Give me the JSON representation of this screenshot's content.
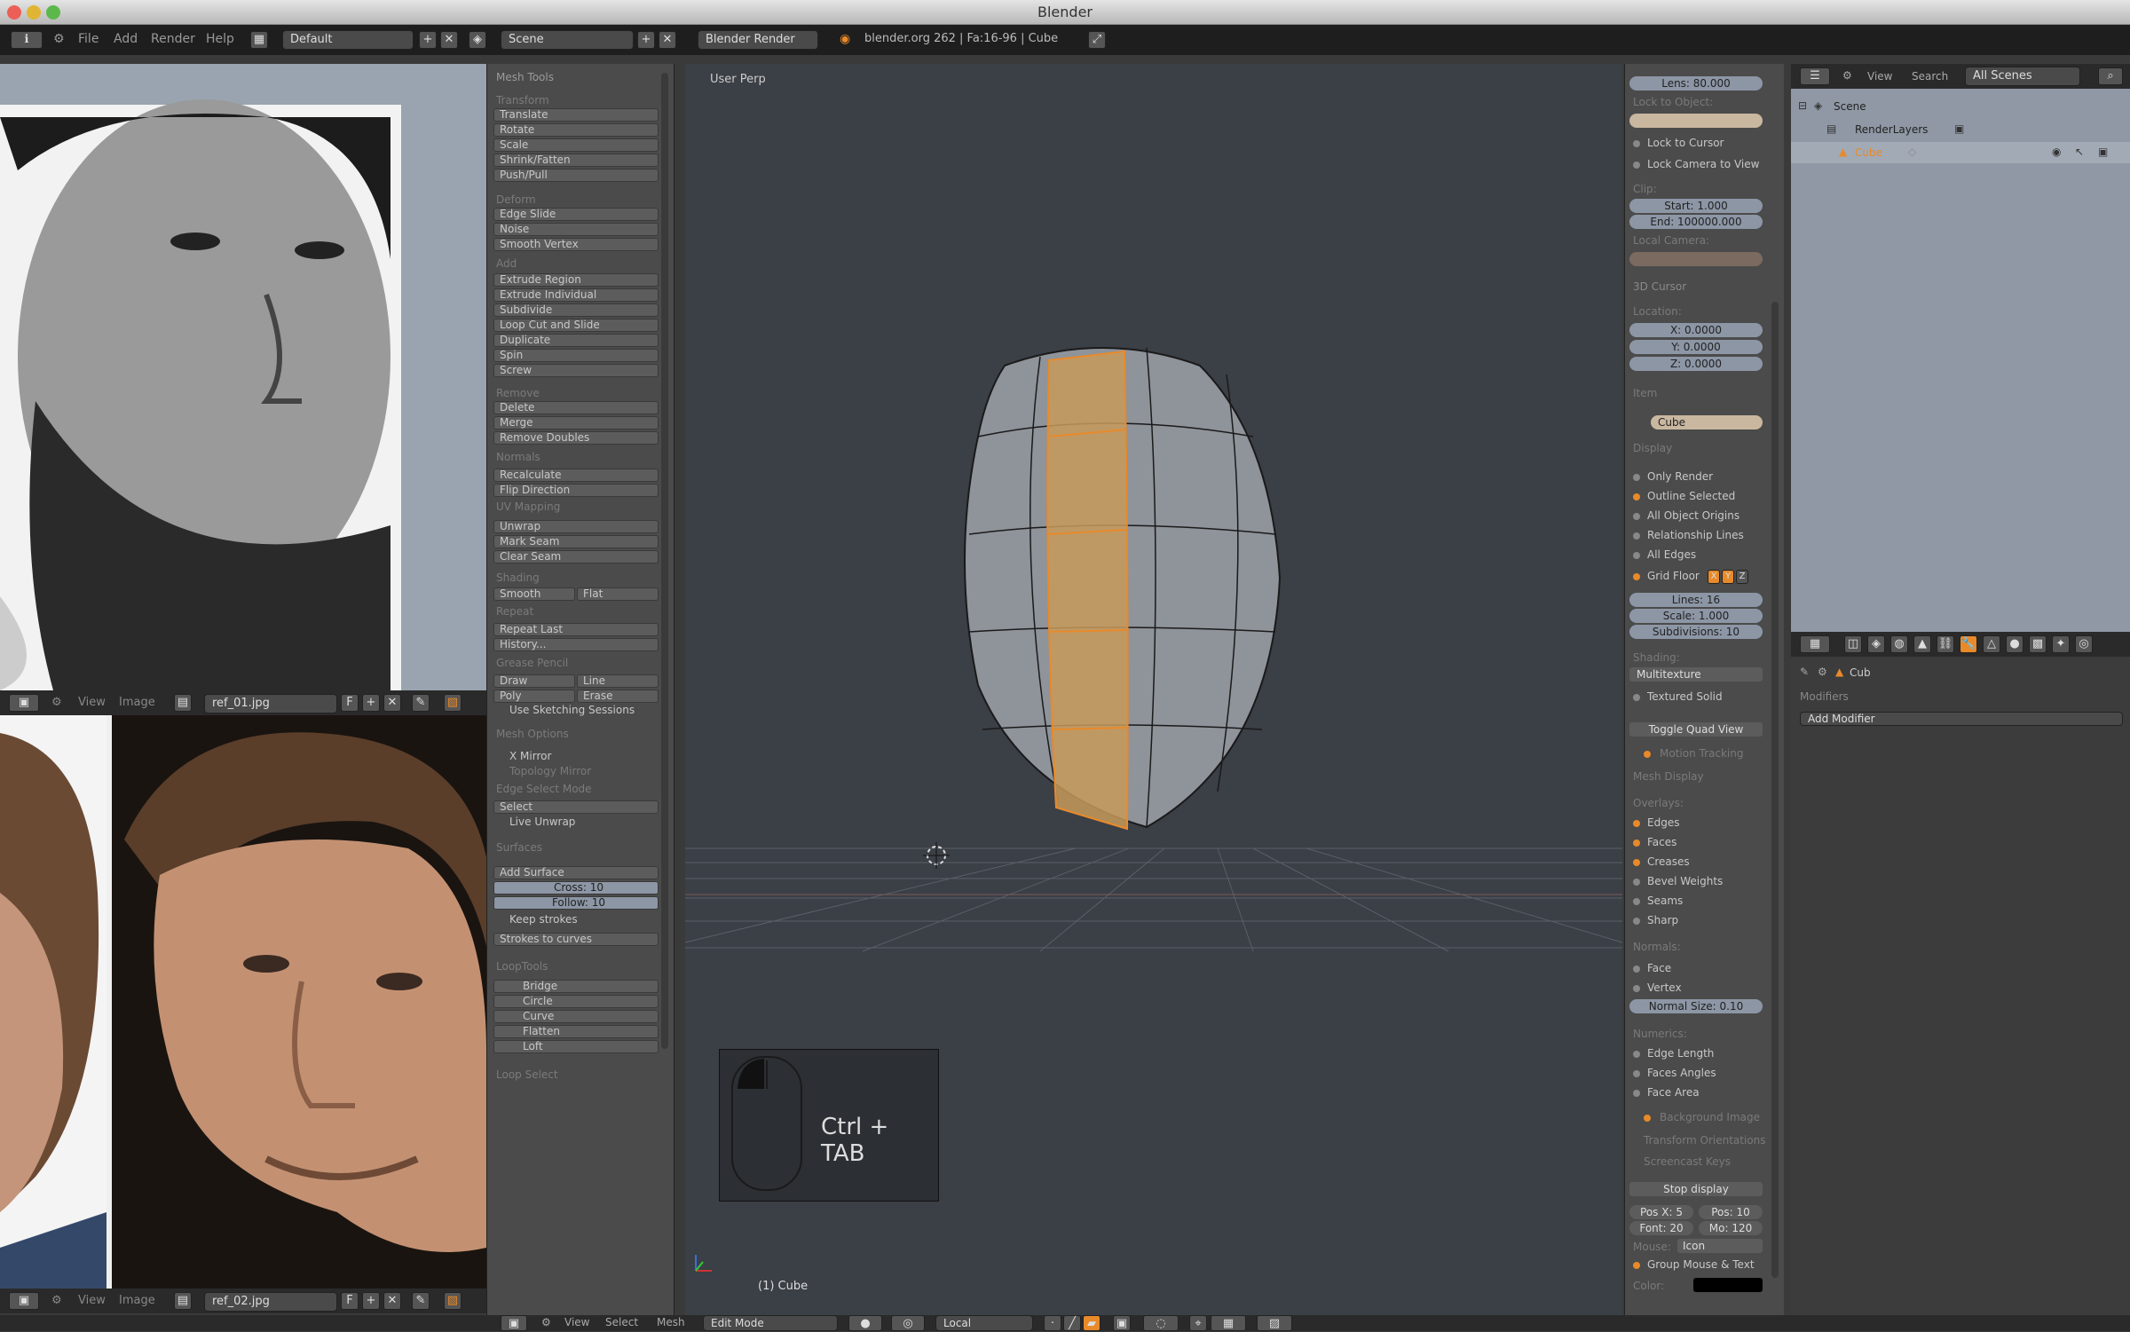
{
  "window": {
    "title": "Blender"
  },
  "menu": {
    "file": "File",
    "add": "Add",
    "render": "Render",
    "help": "Help"
  },
  "topbar": {
    "layout": "Default",
    "scene": "Scene",
    "engine": "Blender Render",
    "stats": "blender.org 262 | Fa:16-96 | Cube"
  },
  "image_editor_top": {
    "view": "View",
    "image": "Image",
    "image_name": "ref_01.jpg",
    "letter": "F"
  },
  "image_editor_bottom": {
    "view": "View",
    "image": "Image",
    "image_name": "ref_02.jpg",
    "letter": "F"
  },
  "toolshelf": {
    "title": "Mesh Tools",
    "sections": {
      "transform": "Transform",
      "deform": "Deform",
      "add": "Add",
      "remove": "Remove",
      "normals": "Normals",
      "uv": "UV Mapping",
      "shading": "Shading",
      "repeat": "Repeat",
      "grease": "Grease Pencil",
      "mesh_options": "Mesh Options",
      "edge_select_mode": "Edge Select Mode",
      "surfaces": "Surfaces",
      "looptools": "LoopTools",
      "loop_select": "Loop Select"
    },
    "buttons": {
      "translate": "Translate",
      "rotate": "Rotate",
      "scale": "Scale",
      "shrink": "Shrink/Fatten",
      "push": "Push/Pull",
      "edge_slide": "Edge Slide",
      "noise": "Noise",
      "smooth_vertex": "Smooth Vertex",
      "extrude_region": "Extrude Region",
      "extrude_individual": "Extrude Individual",
      "subdivide": "Subdivide",
      "loop_cut": "Loop Cut and Slide",
      "duplicate": "Duplicate",
      "spin": "Spin",
      "screw": "Screw",
      "delete": "Delete",
      "merge": "Merge",
      "remove_doubles": "Remove Doubles",
      "recalculate": "Recalculate",
      "flip_direction": "Flip Direction",
      "unwrap": "Unwrap",
      "mark_seam": "Mark Seam",
      "clear_seam": "Clear Seam",
      "smooth": "Smooth",
      "flat": "Flat",
      "repeat_last": "Repeat Last",
      "history": "History...",
      "draw": "Draw",
      "line": "Line",
      "poly": "Poly",
      "erase": "Erase",
      "use_sketching": "Use Sketching Sessions",
      "x_mirror": "X Mirror",
      "topology_mirror": "Topology Mirror",
      "select": "Select",
      "live_unwrap": "Live Unwrap",
      "add_surface": "Add Surface",
      "cross": "Cross: 10",
      "follow": "Follow: 10",
      "keep_strokes": "Keep strokes",
      "strokes_to_curves": "Strokes to curves",
      "bridge": "Bridge",
      "circle": "Circle",
      "curve": "Curve",
      "flatten": "Flatten",
      "loft": "Loft"
    }
  },
  "viewport": {
    "label": "User Perp",
    "object_label": "(1) Cube",
    "key_hint": "Ctrl + TAB"
  },
  "npanel": {
    "lens": "Lens: 80.000",
    "lock_to_object": "Lock to Object:",
    "lock_to_cursor": "Lock to Cursor",
    "lock_camera": "Lock Camera to View",
    "clip": "Clip:",
    "clip_start": "Start: 1.000",
    "clip_end": "End: 100000.000",
    "local_camera": "Local Camera:",
    "cursor_section": "3D Cursor",
    "location": "Location:",
    "x": "X: 0.0000",
    "y": "Y: 0.0000",
    "z": "Z: 0.0000",
    "item": "Item",
    "item_name": "Cube",
    "display": "Display",
    "only_render": "Only Render",
    "outline_selected": "Outline Selected",
    "all_origins": "All Object Origins",
    "relationship_lines": "Relationship Lines",
    "all_edges": "All Edges",
    "grid_floor": "Grid Floor",
    "axis_x": "X",
    "axis_y": "Y",
    "axis_z": "Z",
    "lines": "Lines: 16",
    "grid_scale": "Scale: 1.000",
    "subdivisions": "Subdivisions: 10",
    "shading": "Shading:",
    "shading_mode": "Multitexture",
    "textured_solid": "Textured Solid",
    "toggle_quad": "Toggle Quad View",
    "motion_tracking": "Motion Tracking",
    "mesh_display": "Mesh Display",
    "overlays": "Overlays:",
    "edges": "Edges",
    "faces": "Faces",
    "creases": "Creases",
    "bevel_weights": "Bevel Weights",
    "seams": "Seams",
    "sharp": "Sharp",
    "normals": "Normals:",
    "face": "Face",
    "vertex": "Vertex",
    "normal_size": "Normal Size: 0.10",
    "numerics": "Numerics:",
    "edge_length": "Edge Length",
    "face_angles": "Faces Angles",
    "face_area": "Face Area",
    "background_image": "Background Image",
    "transform_orientations": "Transform Orientations",
    "screencast_keys": "Screencast Keys",
    "stop_display": "Stop display",
    "pos_x": "Pos X: 5",
    "pos_y": "Pos: 10",
    "font": "Font: 20",
    "mouse_size": "Mo: 120",
    "mouse_label": "Mouse:",
    "mouse_mode": "Icon",
    "group_mouse": "Group Mouse & Text",
    "color_label": "Color:"
  },
  "outliner": {
    "view": "View",
    "search": "Search",
    "scenes": "All Scenes",
    "scene": "Scene",
    "renderlayers": "RenderLayers",
    "cube": "Cube"
  },
  "properties": {
    "object_name": "Cub",
    "modifiers": "Modifiers",
    "add_modifier": "Add Modifier"
  },
  "bottombar": {
    "view": "View",
    "select": "Select",
    "mesh": "Mesh",
    "mode": "Edit Mode",
    "orientation": "Local"
  },
  "colors": {
    "accent": "#e88a2a",
    "viewport": "#3b3f46",
    "panel": "#4b4b4b"
  }
}
